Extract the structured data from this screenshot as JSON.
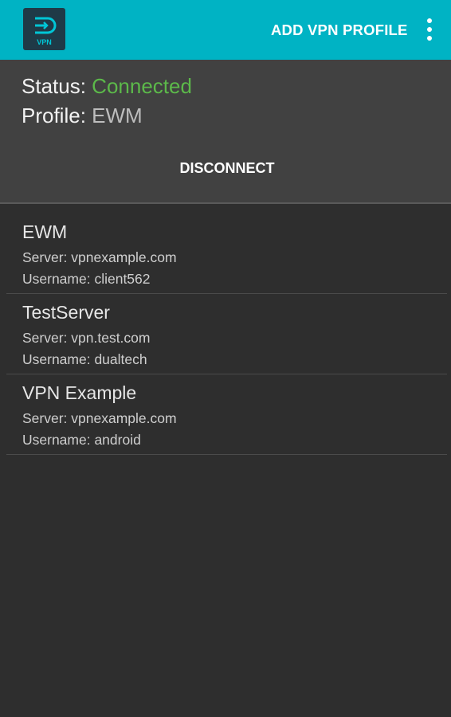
{
  "appbar": {
    "icon": "vpn-app-icon",
    "icon_text": "VPN",
    "add_profile_label": "ADD VPN PROFILE",
    "overflow_icon": "more-vert-icon"
  },
  "status": {
    "status_label": "Status:",
    "status_value": "Connected",
    "profile_label": "Profile:",
    "profile_value": "EWM",
    "disconnect_label": "DISCONNECT"
  },
  "profiles": [
    {
      "name": "EWM",
      "server": "Server: vpnexample.com",
      "username": "Username: client562"
    },
    {
      "name": "TestServer",
      "server": "Server: vpn.test.com",
      "username": "Username: dualtech"
    },
    {
      "name": "VPN Example",
      "server": "Server: vpnexample.com",
      "username": "Username: android"
    }
  ],
  "colors": {
    "appbar": "#00b3c4",
    "connected": "#5cb94a",
    "background": "#2e2e2e",
    "panel": "#414141"
  }
}
